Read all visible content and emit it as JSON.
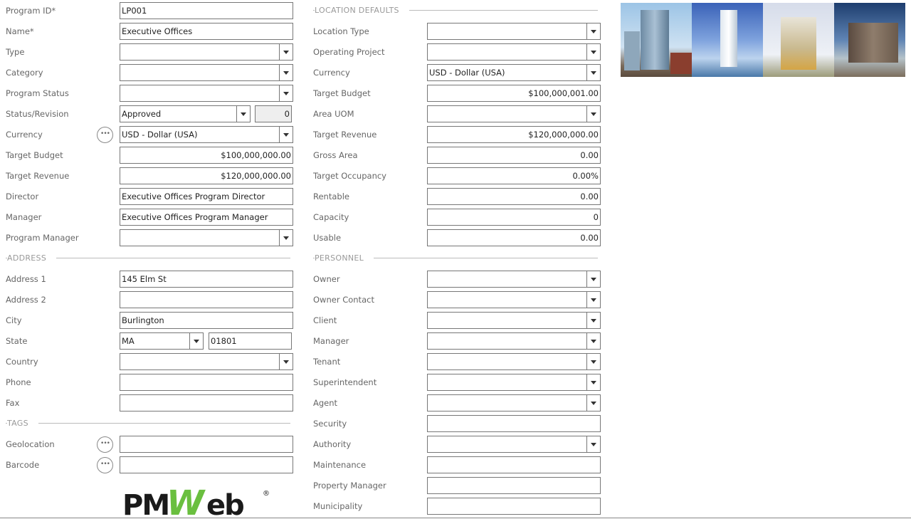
{
  "left": [
    {
      "label": "Program ID*",
      "type": "text",
      "value": "LP001"
    },
    {
      "label": "Name*",
      "type": "text",
      "value": "Executive Offices"
    },
    {
      "label": "Type",
      "type": "select",
      "value": ""
    },
    {
      "label": "Category",
      "type": "select",
      "value": ""
    },
    {
      "label": "Program Status",
      "type": "select",
      "value": ""
    },
    {
      "label": "Status/Revision",
      "type": "status",
      "value": "Approved",
      "revision": "0"
    },
    {
      "label": "Currency",
      "type": "select",
      "value": "USD - Dollar (USA)",
      "dots": true
    },
    {
      "label": "Target Budget",
      "type": "num",
      "value": "$100,000,000.00"
    },
    {
      "label": "Target Revenue",
      "type": "num",
      "value": "$120,000,000.00"
    },
    {
      "label": "Director",
      "type": "text",
      "value": "Executive Offices Program Director"
    },
    {
      "label": "Manager",
      "type": "text",
      "value": "Executive Offices Program Manager"
    },
    {
      "label": "Program Manager",
      "type": "select",
      "value": ""
    },
    {
      "section": "ADDRESS"
    },
    {
      "label": "Address 1",
      "type": "text",
      "value": "145 Elm St"
    },
    {
      "label": "Address 2",
      "type": "text",
      "value": ""
    },
    {
      "label": "City",
      "type": "text",
      "value": "Burlington"
    },
    {
      "label": "State",
      "type": "state",
      "value": "MA",
      "zip": "01801"
    },
    {
      "label": "Country",
      "type": "select",
      "value": ""
    },
    {
      "label": "Phone",
      "type": "text",
      "value": ""
    },
    {
      "label": "Fax",
      "type": "text",
      "value": ""
    },
    {
      "section": "TAGS"
    },
    {
      "label": "Geolocation",
      "type": "text",
      "value": "",
      "dots": true
    },
    {
      "label": "Barcode",
      "type": "text",
      "value": "",
      "dots": true
    }
  ],
  "right": [
    {
      "section": "LOCATION DEFAULTS"
    },
    {
      "label": "Location Type",
      "type": "select",
      "value": ""
    },
    {
      "label": "Operating Project",
      "type": "select",
      "value": ""
    },
    {
      "label": "Currency",
      "type": "select",
      "value": "USD - Dollar (USA)"
    },
    {
      "label": "Target Budget",
      "type": "num",
      "value": "$100,000,001.00"
    },
    {
      "label": "Area UOM",
      "type": "select",
      "value": ""
    },
    {
      "label": "Target Revenue",
      "type": "num",
      "value": "$120,000,000.00"
    },
    {
      "label": "Gross Area",
      "type": "num",
      "value": "0.00"
    },
    {
      "label": "Target Occupancy",
      "type": "num",
      "value": "0.00%"
    },
    {
      "label": "Rentable",
      "type": "num",
      "value": "0.00"
    },
    {
      "label": "Capacity",
      "type": "num",
      "value": "0"
    },
    {
      "label": "Usable",
      "type": "num",
      "value": "0.00"
    },
    {
      "section": "PERSONNEL"
    },
    {
      "label": "Owner",
      "type": "select",
      "value": ""
    },
    {
      "label": "Owner Contact",
      "type": "select",
      "value": ""
    },
    {
      "label": "Client",
      "type": "select",
      "value": ""
    },
    {
      "label": "Manager",
      "type": "select",
      "value": ""
    },
    {
      "label": "Tenant",
      "type": "select",
      "value": ""
    },
    {
      "label": "Superintendent",
      "type": "select",
      "value": ""
    },
    {
      "label": "Agent",
      "type": "select",
      "value": ""
    },
    {
      "label": "Security",
      "type": "text",
      "value": ""
    },
    {
      "label": "Authority",
      "type": "select",
      "value": ""
    },
    {
      "label": "Maintenance",
      "type": "text",
      "value": ""
    },
    {
      "label": "Property Manager",
      "type": "text",
      "value": ""
    },
    {
      "label": "Municipality",
      "type": "text",
      "value": ""
    }
  ],
  "images": [
    "building-photo-1",
    "building-photo-2",
    "building-photo-3",
    "building-photo-4"
  ],
  "logo": {
    "text": "PMWeb",
    "accent": "#6abf3f"
  },
  "icons": {
    "more": "ellipsis-icon",
    "dropdown": "chevron-down-icon"
  }
}
